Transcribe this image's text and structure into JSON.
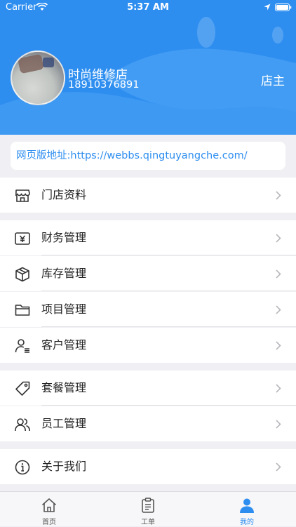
{
  "status_bar": {
    "carrier": "Carrier",
    "time": "5:37 AM"
  },
  "profile": {
    "shop_name": "时尚维修店",
    "phone": "18910376891",
    "role": "店主"
  },
  "web_url": "网页版地址:https://webbs.qingtuyangche.com/",
  "menu": [
    {
      "label": "门店资料",
      "icon": "store-icon"
    },
    {
      "label": "财务管理",
      "icon": "yen-icon"
    },
    {
      "label": "库存管理",
      "icon": "box-icon"
    },
    {
      "label": "项目管理",
      "icon": "folder-icon"
    },
    {
      "label": "客户管理",
      "icon": "customer-list-icon"
    },
    {
      "label": "套餐管理",
      "icon": "tag-icon"
    },
    {
      "label": "员工管理",
      "icon": "staff-icon"
    },
    {
      "label": "关于我们",
      "icon": "info-icon"
    }
  ],
  "tabs": [
    {
      "label": "首页",
      "icon": "home-icon"
    },
    {
      "label": "工单",
      "icon": "clipboard-icon"
    },
    {
      "label": "我的",
      "icon": "user-icon",
      "active": true
    }
  ],
  "colors": {
    "brand": "#2e8ef0",
    "background": "#efeff4"
  }
}
